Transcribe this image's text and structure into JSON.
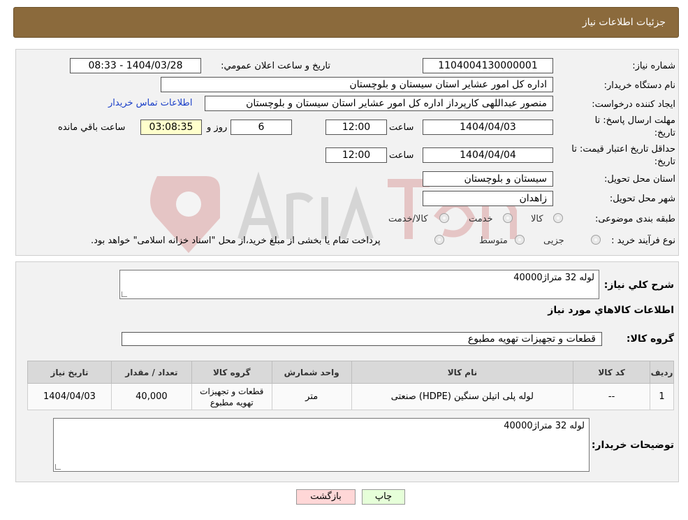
{
  "header": {
    "title": "جزئیات اطلاعات نیاز"
  },
  "form": {
    "need_number_label": "شماره نیاز:",
    "need_number": "1104004130000001",
    "announce_label": "تاريخ و ساعت اعلان عمومي:",
    "announce_value": "1404/03/28 - 08:33",
    "buyer_org_label": "نام دستگاه خریدار:",
    "buyer_org": "اداره کل امور عشایر استان سیستان و بلوچستان",
    "creator_label": "ایجاد کننده درخواست:",
    "creator": "منصور عبداللهی کارپرداز اداره کل امور عشایر استان سیستان و بلوچستان",
    "contact_link": "اطلاعات تماس خریدار",
    "deadline_label": "مهلت ارسال پاسخ: تا تاریخ:",
    "deadline_date": "1404/04/03",
    "time_label": "ساعت",
    "deadline_time": "12:00",
    "days_value": "6",
    "days_label": "روز و",
    "remaining_time": "03:08:35",
    "remaining_label": "ساعت باقي مانده",
    "validity_label": "حداقل تاریخ اعتبار قیمت: تا تاریخ:",
    "validity_date": "1404/04/04",
    "validity_time": "12:00",
    "province_label": "استان محل تحویل:",
    "province": "سیستان و بلوچستان",
    "city_label": "شهر محل تحویل:",
    "city": "زاهدان",
    "category_label": "طبقه بندی موضوعی:",
    "category_options": [
      "کالا",
      "خدمت",
      "کالا/خدمت"
    ],
    "process_label": "نوع فرآیند خرید :",
    "process_options": [
      "جزیی",
      "متوسط"
    ],
    "process_note": "پرداخت تمام یا بخشی از مبلغ خرید،از محل \"اسناد خزانه اسلامی\" خواهد بود."
  },
  "details": {
    "summary_label": "شرح کلي نياز:",
    "summary": "لوله 32 متراژ40000",
    "goods_info_title": "اطلاعات کالاهاي مورد نياز",
    "goods_group_label": "گروه کالا:",
    "goods_group": "قطعات و تجهیزات تهویه مطبوع",
    "table": {
      "headers": [
        "رديف",
        "کد کالا",
        "نام کالا",
        "واحد شمارش",
        "گروه کالا",
        "تعداد / مقدار",
        "تاریخ نیاز"
      ],
      "rows": [
        [
          "1",
          "--",
          "لوله پلی اتیلن سنگین (HDPE) صنعتی",
          "متر",
          "قطعات و تجهیزات تهویه مطبوع",
          "40,000",
          "1404/04/03"
        ]
      ]
    },
    "buyer_notes_label": "توضیحات خریدار:",
    "buyer_notes": "لوله 32 متراژ40000"
  },
  "buttons": {
    "back": "بازگشت",
    "print": "چاپ"
  },
  "colors": {
    "header_bg": "#8b6a3c",
    "link": "#1a3fc8",
    "back_btn": "#ffd7d7",
    "print_btn": "#e6ffd9"
  }
}
